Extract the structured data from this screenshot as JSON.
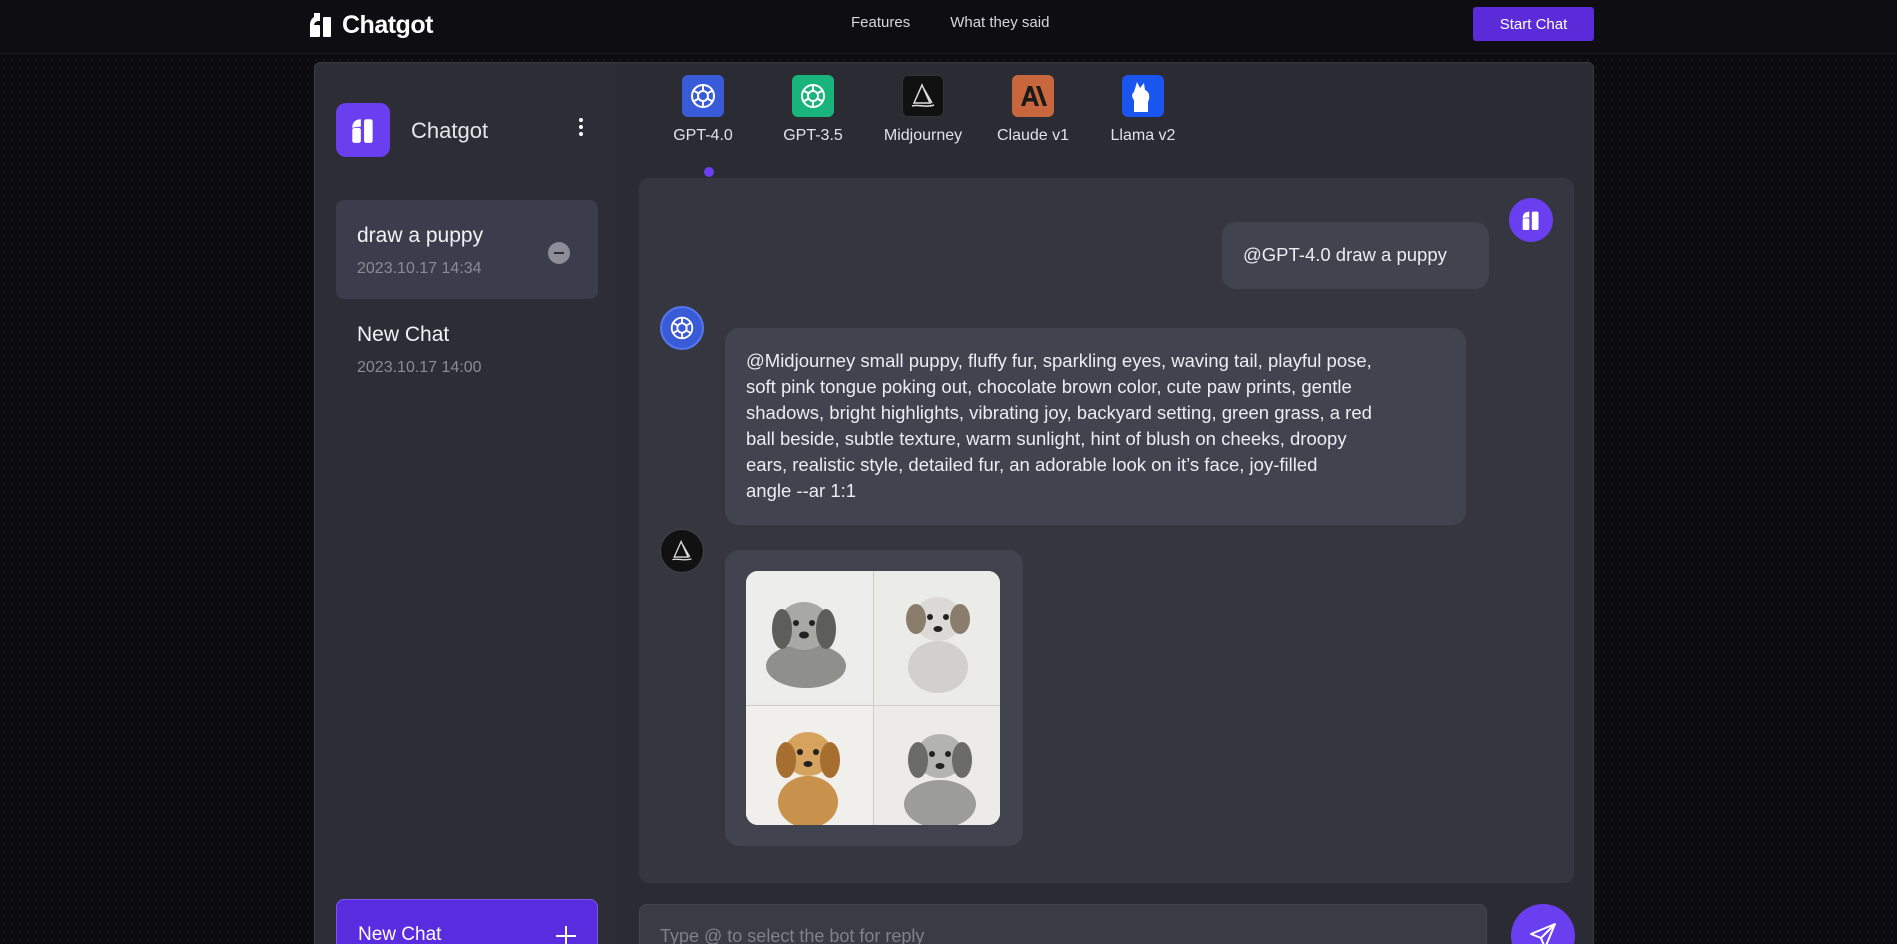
{
  "nav": {
    "brand": "Chatgot",
    "links": [
      "Features",
      "What they said"
    ],
    "cta": "Start Chat"
  },
  "sidebar": {
    "title": "Chatgot",
    "chats": [
      {
        "title": "draw a puppy",
        "time": "2023.10.17 14:34",
        "active": true
      },
      {
        "title": "New Chat",
        "time": "2023.10.17 14:00",
        "active": false
      }
    ],
    "new_chat_label": "New Chat"
  },
  "bots": [
    {
      "label": "GPT-4.0",
      "icon": "openai-icon",
      "color": "#3a5bd8",
      "selected": true
    },
    {
      "label": "GPT-3.5",
      "icon": "openai-icon",
      "color": "#19b47c",
      "selected": false
    },
    {
      "label": "Midjourney",
      "icon": "sailboat-icon",
      "color": "#111111",
      "selected": false
    },
    {
      "label": "Claude v1",
      "icon": "anthropic-icon",
      "color": "#c8673d",
      "selected": false
    },
    {
      "label": "Llama v2",
      "icon": "llama-icon",
      "color": "#1a55f0",
      "selected": false
    }
  ],
  "messages": {
    "user": "@GPT-4.0 draw a puppy",
    "gpt": "@Midjourney small puppy, fluffy fur, sparkling eyes, waving tail, playful pose,\n soft pink tongue poking out, chocolate brown color, cute paw prints, gentle\nshadows, bright highlights, vibrating joy, backyard setting, green grass, a red\n ball beside, subtle texture, warm sunlight, hint of blush on cheeks, droopy\nears, realistic style, detailed fur, an adorable look on it’s face, joy-filled\nangle --ar 1:1"
  },
  "composer": {
    "placeholder": "Type @ to select the bot for reply"
  },
  "colors": {
    "accent": "#6a3ff0",
    "button": "#5b2bd9"
  }
}
